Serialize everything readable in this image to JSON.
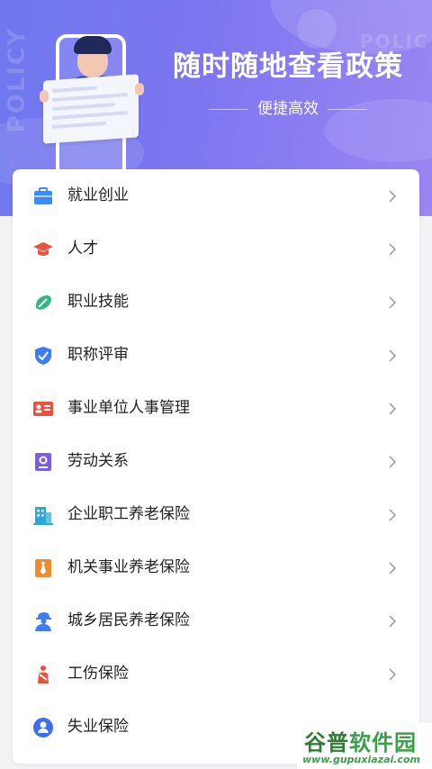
{
  "banner": {
    "title": "随时随地查看政策",
    "subtitle": "便捷高效",
    "watermark_left": "POLICY",
    "watermark_right": "POLIC"
  },
  "menu": {
    "items": [
      {
        "label": "就业创业",
        "icon": "briefcase-icon",
        "color": "#3d8bf2"
      },
      {
        "label": "人才",
        "icon": "graduation-cap-icon",
        "color": "#e8523f"
      },
      {
        "label": "职业技能",
        "icon": "wrench-leaf-icon",
        "color": "#2fb784"
      },
      {
        "label": "职称评审",
        "icon": "shield-check-icon",
        "color": "#3d7cf2"
      },
      {
        "label": "事业单位人事管理",
        "icon": "id-card-icon",
        "color": "#e8523f"
      },
      {
        "label": "劳动关系",
        "icon": "contract-book-icon",
        "color": "#7a5ce6"
      },
      {
        "label": "企业职工养老保险",
        "icon": "building-icon",
        "color": "#2ba7d8"
      },
      {
        "label": "机关事业养老保险",
        "icon": "tie-document-icon",
        "color": "#f08a2a"
      },
      {
        "label": "城乡居民养老保险",
        "icon": "worker-icon",
        "color": "#3d7cf2"
      },
      {
        "label": "工伤保险",
        "icon": "injured-person-icon",
        "color": "#e8523f"
      },
      {
        "label": "失业保险",
        "icon": "person-circle-icon",
        "color": "#3d6ef2"
      }
    ],
    "chevron_icon": "chevron-right-icon"
  },
  "watermark_brand": {
    "name_part1": "谷普",
    "name_part2": "软件园",
    "url": "www.gupuxiazai.com"
  }
}
